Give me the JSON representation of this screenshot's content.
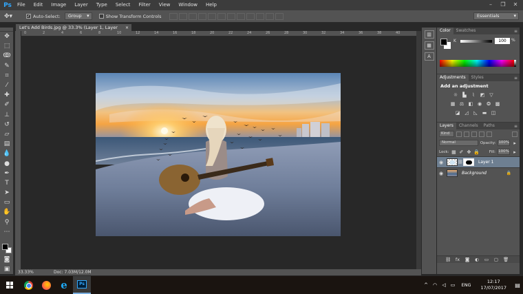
{
  "menu": [
    "File",
    "Edit",
    "Image",
    "Layer",
    "Type",
    "Select",
    "Filter",
    "View",
    "Window",
    "Help"
  ],
  "logo": "Ps",
  "options": {
    "auto_select_label": "Auto-Select:",
    "auto_select_value": "Group",
    "transform_label": "Show Transform Controls",
    "workspace": "Essentials"
  },
  "document": {
    "tab_title": "Let's Add Birds.jpg @ 33.3% (Layer 1, Layer Mask/8) *",
    "tab_close": "×",
    "zoom": "33.33%",
    "doc_size": "Doc: 7.03M/12.0M",
    "ruler_ticks": [
      "0",
      "2",
      "4",
      "6",
      "8",
      "10",
      "12",
      "14",
      "16",
      "18",
      "20",
      "22",
      "24",
      "26",
      "28",
      "30",
      "32",
      "34",
      "36",
      "38",
      "40"
    ]
  },
  "color_panel": {
    "tabs": [
      "Color",
      "Swatches"
    ],
    "channel": "K",
    "value": "100",
    "unit": "%"
  },
  "adjustments_panel": {
    "tabs": [
      "Adjustments",
      "Styles"
    ],
    "title": "Add an adjustment"
  },
  "layers_panel": {
    "tabs": [
      "Layers",
      "Channels",
      "Paths"
    ],
    "kind": "Kind",
    "blend_mode": "Normal",
    "opacity_label": "Opacity:",
    "opacity": "100%",
    "lock_label": "Lock:",
    "fill_label": "Fill:",
    "fill": "100%",
    "layers": [
      {
        "name": "Layer 1",
        "selected": true
      },
      {
        "name": "Background",
        "selected": false
      }
    ]
  },
  "taskbar": {
    "language": "ENG",
    "time": "12:17",
    "date": "17/07/2017"
  }
}
